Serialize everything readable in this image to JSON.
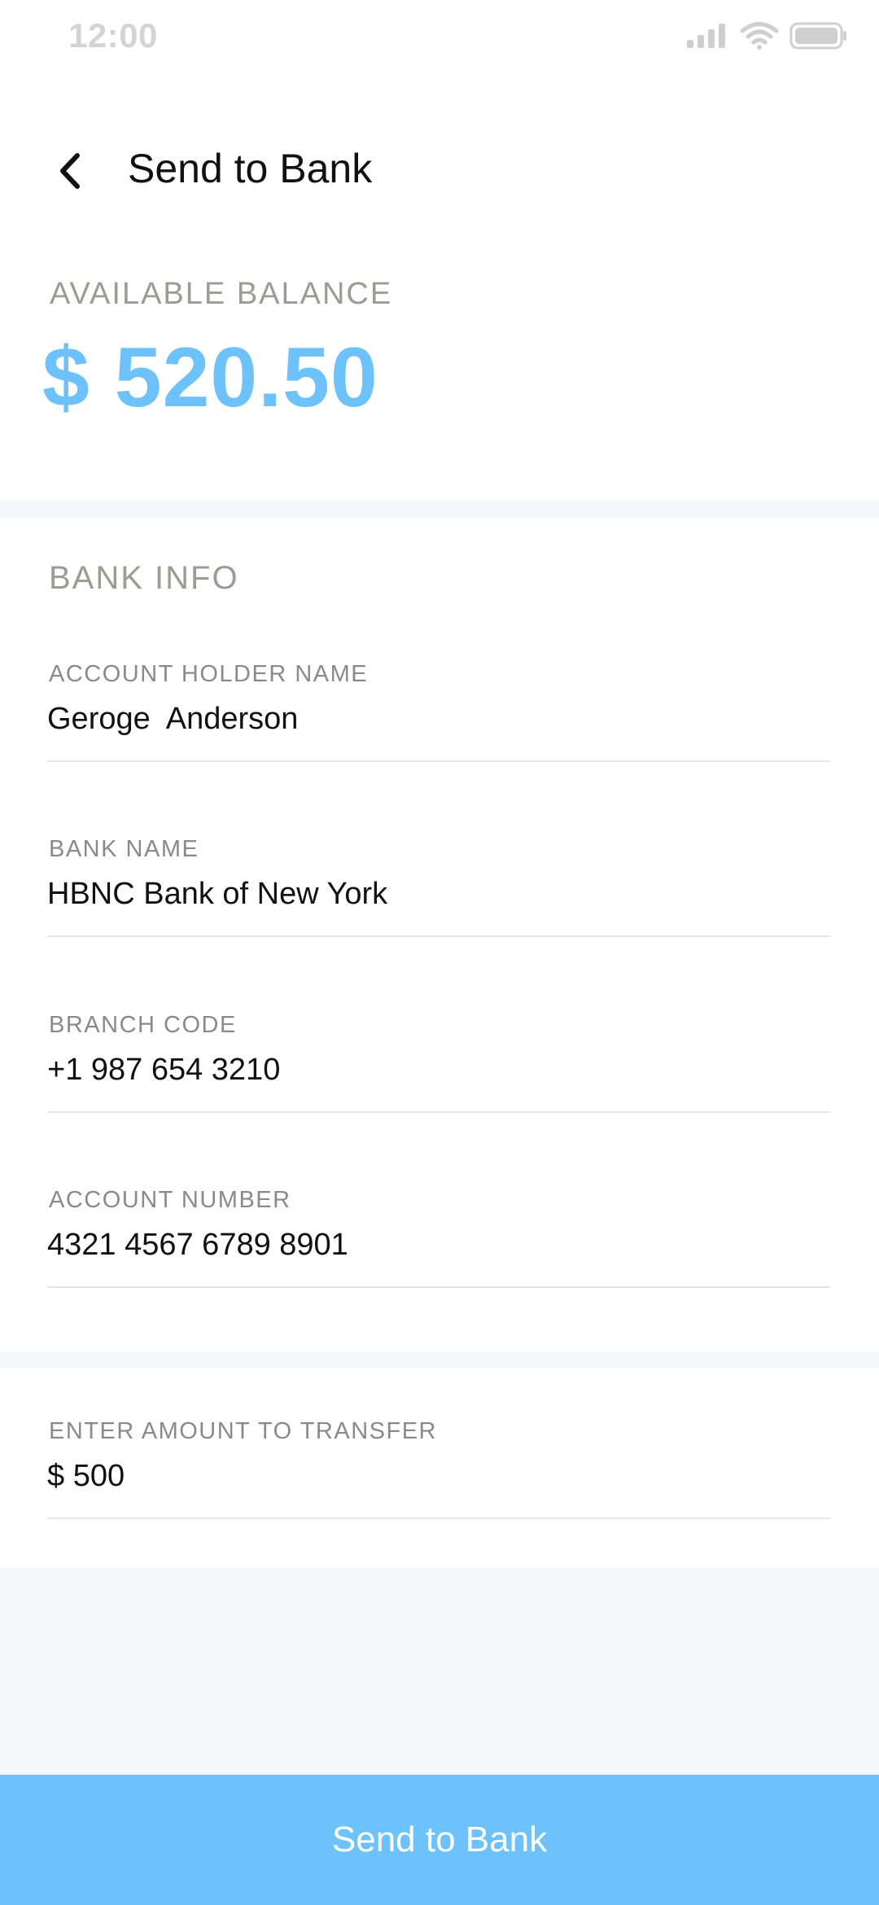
{
  "status_bar": {
    "time": "12:00"
  },
  "header": {
    "title": "Send to Bank"
  },
  "balance": {
    "label": "AVAILABLE BALANCE",
    "value": "$ 520.50"
  },
  "bank_info": {
    "section_title": "BANK INFO",
    "fields": [
      {
        "label": "ACCOUNT HOLDER NAME",
        "value": "Geroge  Anderson"
      },
      {
        "label": "BANK NAME",
        "value": "HBNC Bank of New York"
      },
      {
        "label": "BRANCH CODE",
        "value": "+1 987 654 3210"
      },
      {
        "label": "ACCOUNT NUMBER",
        "value": "4321 4567 6789 8901"
      }
    ]
  },
  "transfer": {
    "label": "ENTER AMOUNT TO TRANSFER",
    "value": "$ 500"
  },
  "actions": {
    "send_label": "Send to Bank"
  },
  "colors": {
    "accent": "#6ec2fb",
    "muted_label": "#9c9c94",
    "band": "#f6f7fb"
  }
}
